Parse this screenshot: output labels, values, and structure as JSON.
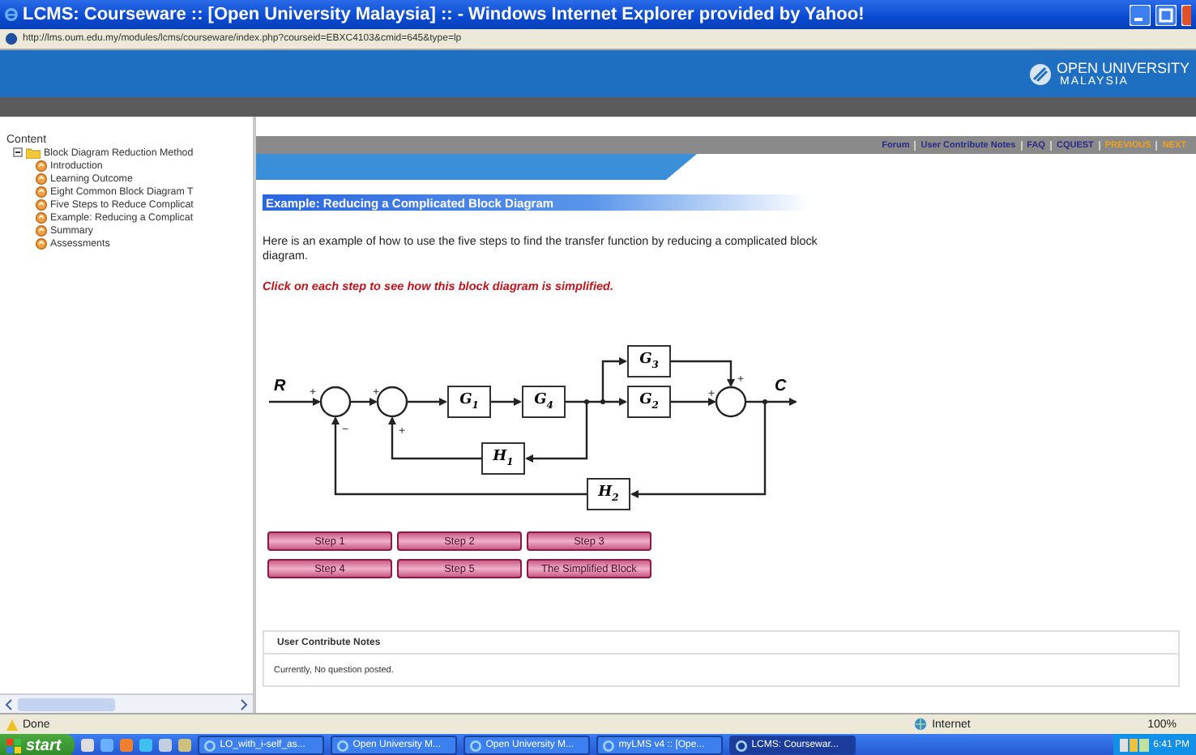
{
  "window": {
    "title": "LCMS: Courseware :: [Open University Malaysia] :: - Windows Internet Explorer provided by Yahoo!"
  },
  "address_bar": {
    "url": "http://lms.oum.edu.my/modules/lcms/courseware/index.php?courseid=EBXC4103&cmid=645&type=lp"
  },
  "header": {
    "logo_line_1": "OPEN UNIVERSITY",
    "logo_line_2": "MALAYSIA"
  },
  "sidebar": {
    "title": "Content",
    "tree": [
      {
        "label": "Block Diagram Reduction Method",
        "expanded": true,
        "children": [
          {
            "label": "Introduction"
          },
          {
            "label": "Learning Outcome"
          },
          {
            "label": "Eight Common Block Diagram T"
          },
          {
            "label": "Five Steps to Reduce Complicat"
          },
          {
            "label": "Example: Reducing a Complicat"
          },
          {
            "label": "Summary"
          },
          {
            "label": "Assessments"
          }
        ]
      }
    ]
  },
  "nav_links": [
    {
      "label": "Forum",
      "color": "#2a2a8a"
    },
    {
      "label": "User Contribute Notes",
      "color": "#2a2a8a"
    },
    {
      "label": "FAQ",
      "color": "#2a2a8a"
    },
    {
      "label": "CQUEST",
      "color": "#2a2a8a"
    },
    {
      "label": "PREVIOUS",
      "color": "#f0a020"
    },
    {
      "label": "NEXT",
      "color": "#f0a020"
    }
  ],
  "content": {
    "heading": "Example: Reducing a Complicated Block Diagram",
    "intro": "Here is an example of how to use the five steps to find the transfer function by reducing a complicated block diagram.",
    "instruction": "Click on each step to see how this block diagram is simplified.",
    "diagram": {
      "input": "R",
      "output": "C",
      "blocks": [
        {
          "label": "G$_{1}$"
        },
        {
          "label": "G$_{4}$"
        },
        {
          "label": "G$_{3}$"
        },
        {
          "label": "G$_{2}$"
        },
        {
          "label": "H$_{1}$"
        },
        {
          "label": "H$_{2}$"
        }
      ],
      "junctions": [
        {
          "signs": [
            "+",
            "−"
          ]
        },
        {
          "signs": [
            "+",
            "+"
          ]
        },
        {
          "signs": [
            "+",
            "+"
          ]
        }
      ]
    },
    "step_buttons": [
      "Step 1",
      "Step 2",
      "Step 3",
      "Step 4",
      "Step 5",
      "The Simplified Block"
    ],
    "notes": {
      "title": "User Contribute Notes",
      "text": "Currently, No question posted."
    }
  },
  "status_bar": {
    "status": "Done",
    "zone": "Internet",
    "zoom": "100%"
  },
  "taskbar": {
    "start": "start",
    "windows": [
      {
        "label": "LO_with_i-self_as...",
        "selected": false
      },
      {
        "label": "Open University M...",
        "selected": false
      },
      {
        "label": "Open University M...",
        "selected": false
      },
      {
        "label": "myLMS v4 :: [Ope...",
        "selected": false
      },
      {
        "label": "LCMS: Coursewar...",
        "selected": true
      }
    ],
    "clock": "6:41 PM"
  }
}
